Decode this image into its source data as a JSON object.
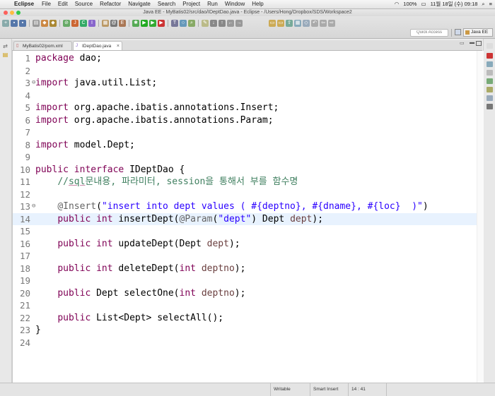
{
  "menubar": {
    "app_name": "Eclipse",
    "items": [
      "File",
      "Edit",
      "Source",
      "Refactor",
      "Navigate",
      "Search",
      "Project",
      "Run",
      "Window",
      "Help"
    ],
    "status": {
      "battery": "100%",
      "datetime": "11월 18일 (수)  09:18"
    }
  },
  "window": {
    "title": "Java EE - MyBatis02/src/dao/IDeptDao.java - Eclipse - /Users/Hong/Dropbox/SDS/Workspace2"
  },
  "toolbar": {
    "quick_access_placeholder": "Quick Access",
    "perspective_label": "Java EE"
  },
  "tabs": [
    {
      "label": "MyBatis02/pom.xml",
      "active": false
    },
    {
      "label": "IDeptDao.java",
      "active": true
    }
  ],
  "editor": {
    "current_line": 14,
    "lines": [
      {
        "n": "1",
        "tokens": [
          [
            "kw",
            "package"
          ],
          [
            "t",
            " dao;"
          ]
        ]
      },
      {
        "n": "2",
        "tokens": []
      },
      {
        "n": "3",
        "fold": "⊖",
        "tokens": [
          [
            "kw",
            "import"
          ],
          [
            "t",
            " java.util.List;"
          ]
        ]
      },
      {
        "n": "4",
        "tokens": []
      },
      {
        "n": "5",
        "tokens": [
          [
            "kw",
            "import"
          ],
          [
            "t",
            " org.apache.ibatis.annotations.Insert;"
          ]
        ]
      },
      {
        "n": "6",
        "tokens": [
          [
            "kw",
            "import"
          ],
          [
            "t",
            " org.apache.ibatis.annotations.Param;"
          ]
        ]
      },
      {
        "n": "7",
        "tokens": []
      },
      {
        "n": "8",
        "tokens": [
          [
            "kw",
            "import"
          ],
          [
            "t",
            " model.Dept;"
          ]
        ]
      },
      {
        "n": "9",
        "tokens": []
      },
      {
        "n": "10",
        "tokens": [
          [
            "kw",
            "public"
          ],
          [
            "t",
            " "
          ],
          [
            "kw",
            "interface"
          ],
          [
            "t",
            " IDeptDao {"
          ]
        ]
      },
      {
        "n": "11",
        "tokens": [
          [
            "t",
            "    "
          ],
          [
            "cm",
            "//"
          ],
          [
            "cmu",
            "sql"
          ],
          [
            "cm",
            "문내용, 파라미터, session을 통해서 부를 함수명"
          ]
        ]
      },
      {
        "n": "12",
        "tokens": []
      },
      {
        "n": "13",
        "fold": "⊖",
        "tokens": [
          [
            "t",
            "    "
          ],
          [
            "ann",
            "@Insert"
          ],
          [
            "t",
            "("
          ],
          [
            "str",
            "\"insert into dept values ( #{deptno}, #{dname}, #{loc}  )\""
          ],
          [
            "t",
            ")"
          ]
        ]
      },
      {
        "n": "14",
        "tokens": [
          [
            "t",
            "    "
          ],
          [
            "kw",
            "public"
          ],
          [
            "t",
            " "
          ],
          [
            "kw",
            "int"
          ],
          [
            "t",
            " insertDept("
          ],
          [
            "ann",
            "@Param"
          ],
          [
            "t",
            "("
          ],
          [
            "str",
            "\"dept\""
          ],
          [
            "t",
            ") Dept "
          ],
          [
            "var",
            "dept"
          ],
          [
            "t",
            ");"
          ]
        ]
      },
      {
        "n": "15",
        "tokens": []
      },
      {
        "n": "16",
        "tokens": [
          [
            "t",
            "    "
          ],
          [
            "kw",
            "public"
          ],
          [
            "t",
            " "
          ],
          [
            "kw",
            "int"
          ],
          [
            "t",
            " updateDept(Dept "
          ],
          [
            "var",
            "dept"
          ],
          [
            "t",
            ");"
          ]
        ]
      },
      {
        "n": "17",
        "tokens": []
      },
      {
        "n": "18",
        "tokens": [
          [
            "t",
            "    "
          ],
          [
            "kw",
            "public"
          ],
          [
            "t",
            " "
          ],
          [
            "kw",
            "int"
          ],
          [
            "t",
            " deleteDept("
          ],
          [
            "kw",
            "int"
          ],
          [
            "t",
            " "
          ],
          [
            "var",
            "deptno"
          ],
          [
            "t",
            ");"
          ]
        ]
      },
      {
        "n": "19",
        "tokens": []
      },
      {
        "n": "20",
        "tokens": [
          [
            "t",
            "    "
          ],
          [
            "kw",
            "public"
          ],
          [
            "t",
            " Dept selectOne("
          ],
          [
            "kw",
            "int"
          ],
          [
            "t",
            " "
          ],
          [
            "var",
            "deptno"
          ],
          [
            "t",
            ");"
          ]
        ]
      },
      {
        "n": "21",
        "tokens": []
      },
      {
        "n": "22",
        "tokens": [
          [
            "t",
            "    "
          ],
          [
            "kw",
            "public"
          ],
          [
            "t",
            " List<Dept> selectAll();"
          ]
        ]
      },
      {
        "n": "23",
        "tokens": [
          [
            "t",
            "}"
          ]
        ]
      },
      {
        "n": "24",
        "tokens": []
      }
    ]
  },
  "statusbar": {
    "mode": "Writable",
    "insert_mode": "Smart Insert",
    "position": "14 : 41"
  },
  "colors": {
    "keyword": "#7f0055",
    "comment": "#3f7f5f",
    "string": "#2a00ff",
    "annotation": "#646464",
    "variable": "#6a3e3e",
    "current_line": "#e8f2fe"
  }
}
